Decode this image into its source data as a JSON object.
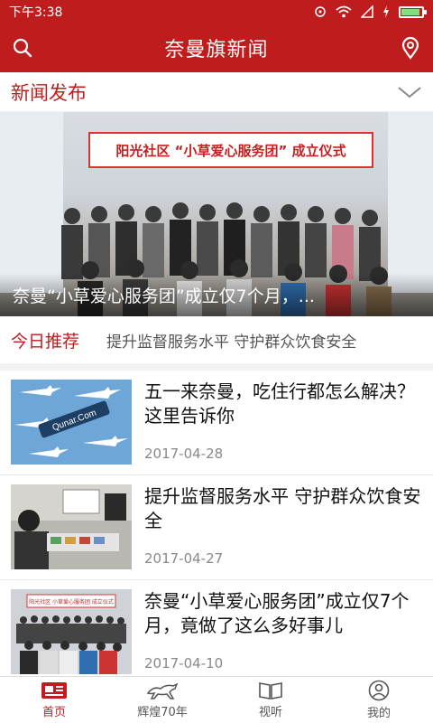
{
  "status_bar": {
    "time": "下午3:38"
  },
  "header": {
    "title": "奈曼旗新闻",
    "search_icon": "search-icon",
    "location_icon": "location-pin-icon"
  },
  "section": {
    "label": "新闻发布",
    "toggle_icon": "chevron-down-icon"
  },
  "banner": {
    "sign_text": "阳光社区 “小草爱心服务团” 成立仪式",
    "caption": "奈曼“小草爱心服务团”成立仅7个月，..."
  },
  "today": {
    "label": "今日推荐",
    "ticker": "提升监督服务水平 守护群众饮食安全"
  },
  "news": [
    {
      "headline": "五一来奈曼，吃住行都怎么解决？这里告诉你",
      "date": "2017-04-28",
      "thumb_text": "Qunar.Com"
    },
    {
      "headline": "提升监督服务水平 守护群众饮食安全",
      "date": "2017-04-27"
    },
    {
      "headline": "奈曼“小草爱心服务团”成立仅7个月，竟做了这么多好事儿",
      "date": "2017-04-10",
      "thumb_sign": "阳光社区 小草爱心服务团 成立仪式"
    }
  ],
  "tabs": [
    {
      "label": "首页",
      "icon": "news-icon",
      "active": true
    },
    {
      "label": "辉煌70年",
      "icon": "horse-icon",
      "active": false
    },
    {
      "label": "视听",
      "icon": "book-icon",
      "active": false
    },
    {
      "label": "我的",
      "icon": "user-icon",
      "active": false
    }
  ],
  "colors": {
    "brand": "#bf1d1d",
    "text": "#111111",
    "muted": "#888888"
  }
}
